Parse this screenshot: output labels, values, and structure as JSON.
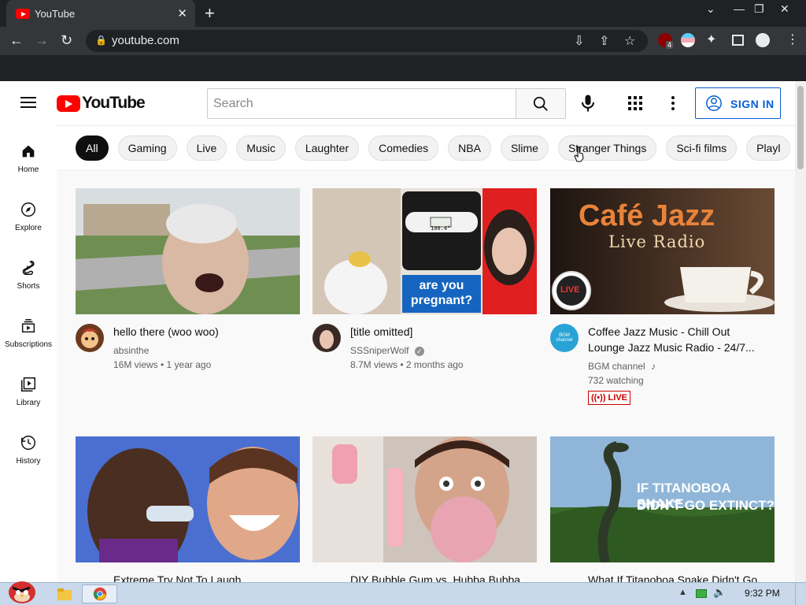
{
  "browser": {
    "tab_title": "YouTube",
    "url": "youtube.com",
    "ublock_count": "4"
  },
  "masthead": {
    "logo_text": "YouTube",
    "search_placeholder": "Search",
    "signin_label": "SIGN IN",
    "accent": "#065fd4",
    "brand": "#ff0000"
  },
  "chips": [
    "All",
    "Gaming",
    "Live",
    "Music",
    "Laughter",
    "Comedies",
    "NBA",
    "Slime",
    "Stranger Things",
    "Sci-fi films",
    "Playl"
  ],
  "sidebar": {
    "items": [
      {
        "label": "Home",
        "icon": "home-icon"
      },
      {
        "label": "Explore",
        "icon": "compass-icon"
      },
      {
        "label": "Shorts",
        "icon": "shorts-icon"
      },
      {
        "label": "Subscriptions",
        "icon": "subscriptions-icon"
      },
      {
        "label": "Library",
        "icon": "library-icon"
      },
      {
        "label": "History",
        "icon": "history-icon"
      }
    ]
  },
  "videos": [
    {
      "title": "hello there (woo woo)",
      "channel": "absinthe",
      "stats": "16M views • 1 year ago"
    },
    {
      "title": "[title omitted]",
      "channel": "SSSniperWolf",
      "verified": true,
      "stats": "8.7M views • 2 months ago",
      "thumb_text": "are you pregnant?",
      "thumb_test_reading": "100.4°"
    },
    {
      "title": "Coffee Jazz Music - Chill Out Lounge Jazz Music Radio - 24/7...",
      "channel": "BGM channel",
      "stats": "732 watching",
      "badge": "LIVE",
      "thumb_title": "Café Jazz",
      "thumb_subtitle": "Live Radio",
      "thumb_badge": "LIVE",
      "avatar_text": "BGM channel"
    },
    {
      "title": "Extreme Try Not To Laugh"
    },
    {
      "title": "DIY Bubble Gum vs. Hubba Bubba"
    },
    {
      "title": "What If Titanoboa Snake Didn't Go",
      "thumb_text_1": "IF TITANOBOA SNAKE",
      "thumb_text_2": "DIDN'T GO EXTINCT?"
    }
  ],
  "taskbar": {
    "clock": "9:32 PM"
  }
}
